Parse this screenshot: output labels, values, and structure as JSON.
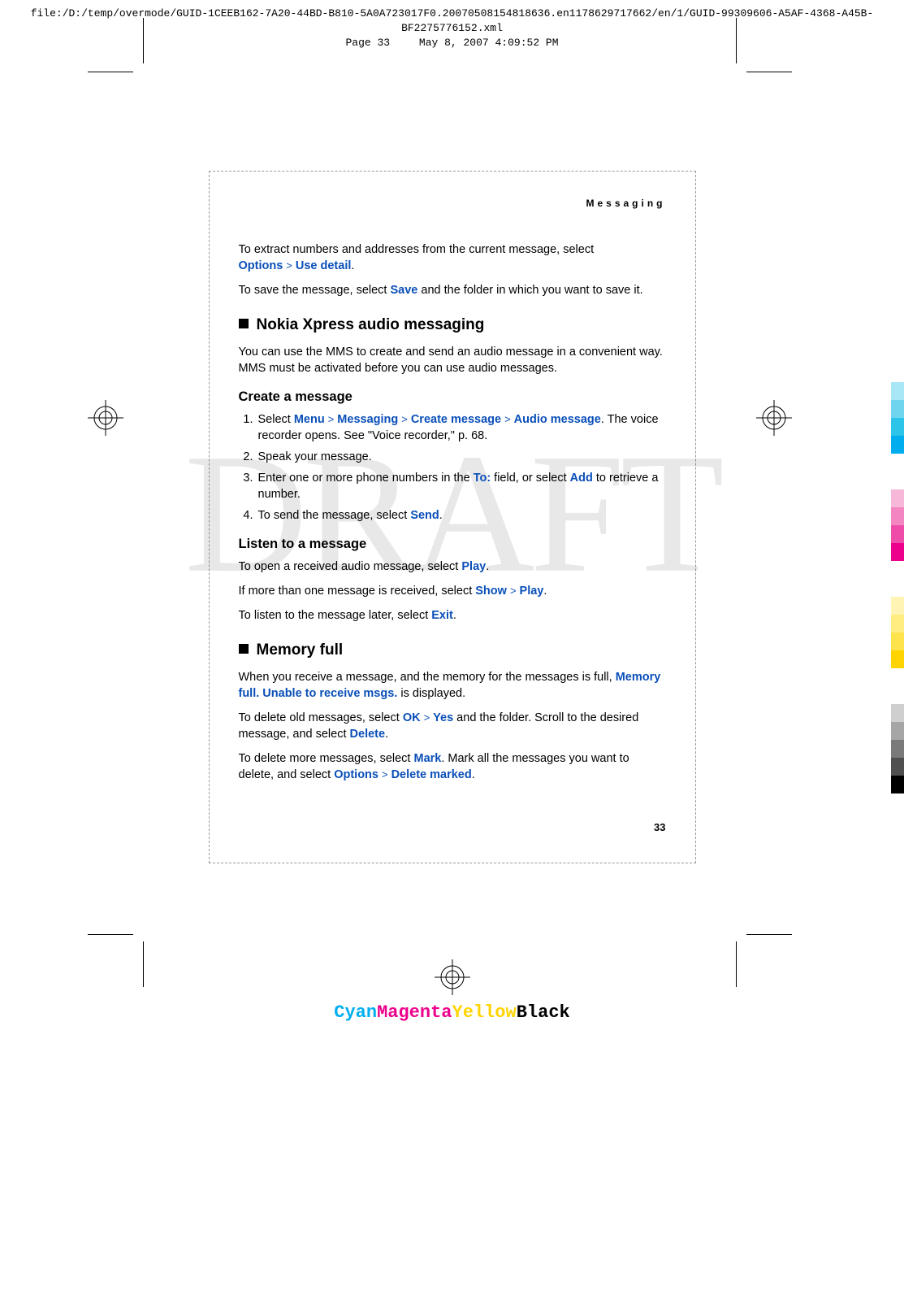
{
  "header": {
    "filepath": "file:/D:/temp/overmode/GUID-1CEEB162-7A20-44BD-B810-5A0A723017F0.20070508154818636.en1178629717662/en/1/GUID-99309606-A5AF-4368-A45B-BF2275776152.xml",
    "page_label": "Page 33",
    "timestamp": "May 8, 2007 4:09:52 PM"
  },
  "running_head": "Messaging",
  "watermark": "DRAFT",
  "intro": {
    "extract_pre": "To extract numbers and addresses from the current message, select ",
    "options": "Options",
    "use_detail": "Use detail",
    "extract_post": ".",
    "save_pre": "To save the message, select ",
    "save": "Save",
    "save_post": " and the folder in which you want to save it."
  },
  "section1": {
    "title": "Nokia Xpress audio messaging",
    "p1": "You can use the MMS to create and send an audio message in a convenient way. MMS must be activated before you can use audio messages.",
    "create_h": "Create a message",
    "step1_pre": "Select ",
    "menu": "Menu",
    "messaging": "Messaging",
    "create_msg": "Create message",
    "audio_msg": "Audio message",
    "step1_post": ". The voice recorder opens. See \"Voice recorder,\" p. 68.",
    "step2": "Speak your message.",
    "step3_pre": "Enter one or more phone numbers in the ",
    "to_field": "To:",
    "step3_mid": " field, or select ",
    "add": "Add",
    "step3_post": " to retrieve a number.",
    "step4_pre": "To send the message, select ",
    "send": "Send",
    "step4_post": ".",
    "listen_h": "Listen to a message",
    "listen1_pre": "To open a received audio message, select ",
    "play": "Play",
    "listen1_post": ".",
    "listen2_pre": "If more than one message is received, select ",
    "show": "Show",
    "listen2_post": ".",
    "listen3_pre": "To listen to the message later, select ",
    "exit": "Exit",
    "listen3_post": "."
  },
  "section2": {
    "title": "Memory full",
    "p1_pre": "When you receive a message, and the memory for the messages is full, ",
    "mem_full_msg": "Memory full. Unable to receive msgs.",
    "p1_post": " is displayed.",
    "p2_pre": "To delete old messages, select ",
    "ok": "OK",
    "yes": "Yes",
    "p2_mid": " and the folder. Scroll to the desired message, and select ",
    "delete": "Delete",
    "p2_post": ".",
    "p3_pre": "To delete more messages, select ",
    "mark": "Mark",
    "p3_mid": ". Mark all the messages you want to delete, and select ",
    "options": "Options",
    "delete_marked": "Delete marked",
    "p3_post": "."
  },
  "page_number": "33",
  "footer": {
    "cyan": "Cyan",
    "magenta": "Magenta",
    "yellow": "Yellow",
    "black": "Black"
  },
  "sep_glyph": ">"
}
